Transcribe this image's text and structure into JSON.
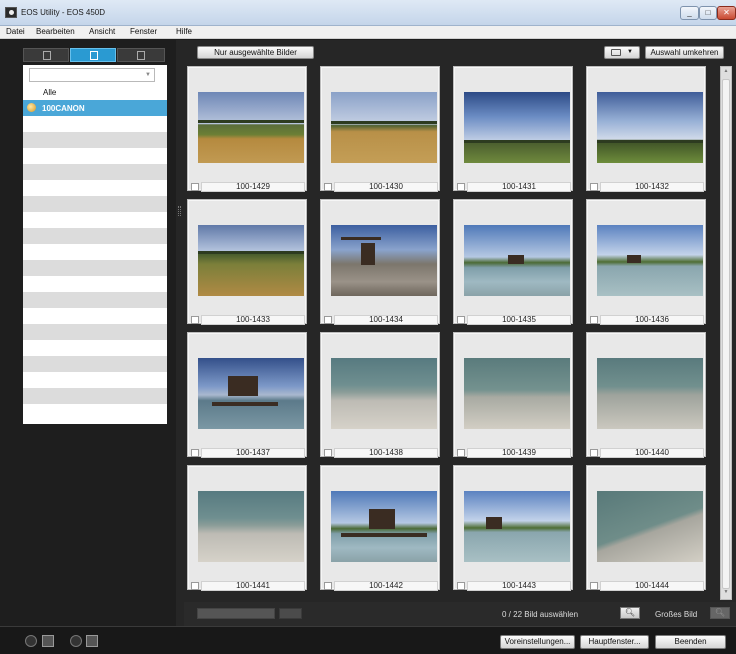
{
  "window": {
    "title": "EOS Utility - EOS 450D"
  },
  "menu": [
    "Datei",
    "Bearbeiten",
    "Ansicht",
    "Fenster",
    "Hilfe"
  ],
  "folders": {
    "all_label": "Alle",
    "selected_folder": "100CANON"
  },
  "toolbar": {
    "only_selected_label": "Nur ausgewählte Bilder",
    "invert_selection_label": "Auswahl umkehren"
  },
  "images": [
    "100-1429",
    "100-1430",
    "100-1431",
    "100-1432",
    "100-1433",
    "100-1434",
    "100-1435",
    "100-1436",
    "100-1437",
    "100-1438",
    "100-1439",
    "100-1440",
    "100-1441",
    "100-1442",
    "100-1443",
    "100-1444"
  ],
  "bottom": {
    "selection_count": "0 / 22 Bild auswählen",
    "large_image_label": "Großes Bild"
  },
  "status": {
    "preferences_label": "Voreinstellungen...",
    "main_window_label": "Hauptfenster...",
    "quit_label": "Beenden"
  }
}
